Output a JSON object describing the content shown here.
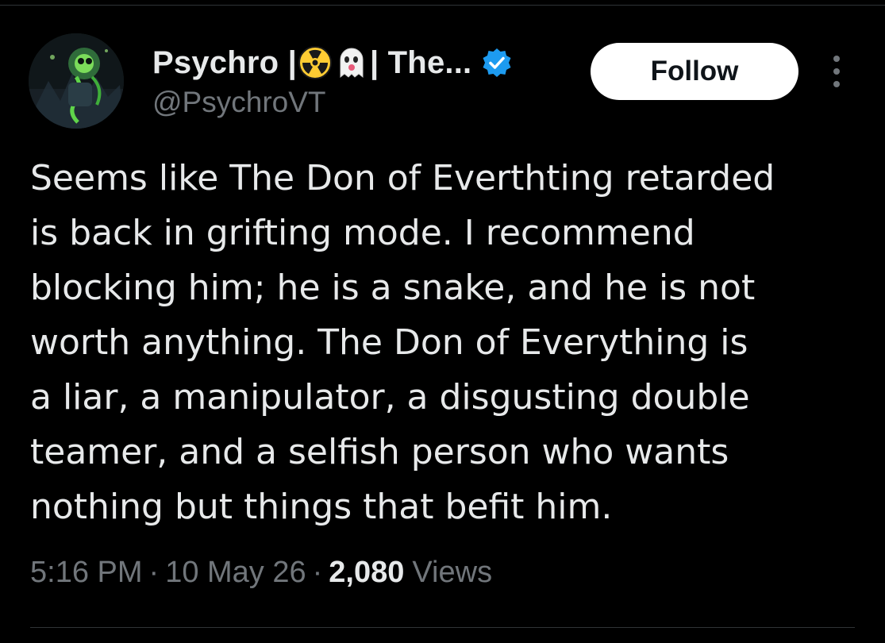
{
  "tweet": {
    "author": {
      "display_name": "Psychro |",
      "name_emoji_1": "radioactive-icon",
      "name_emoji_2": "ghost-icon",
      "display_name_suffix": "| The...",
      "handle": "@PsychroVT",
      "verified": true,
      "verified_color": "#1d9bf0"
    },
    "follow_label": "Follow",
    "text_lines": [
      "Seems like The Don of Everthting retarded",
      "is back in grifting mode. I recommend",
      "blocking him; he is a snake, and he is not",
      "worth anything. The Don of Everything is",
      "a liar, a manipulator, a disgusting double",
      "teamer, and a selfish person who wants",
      "nothing but things that befit him."
    ],
    "time": "5:16 PM",
    "separator": "·",
    "date": "10 May 26",
    "views_count": "2,080",
    "views_label": "Views"
  },
  "colors": {
    "background": "#000000",
    "text_primary": "#e7e9ea",
    "text_secondary": "#71767b",
    "button_bg": "#ffffff",
    "divider": "#2f3336"
  }
}
